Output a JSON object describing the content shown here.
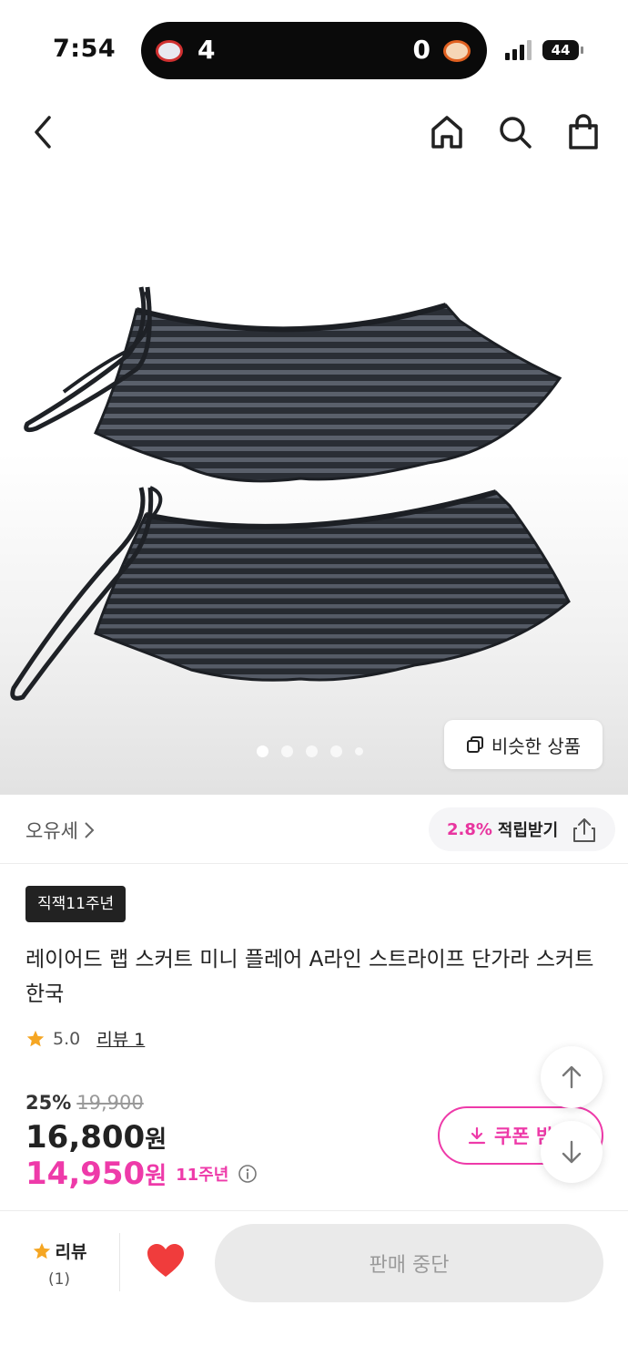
{
  "status_bar": {
    "time": "7:54",
    "live_activity": {
      "home_score": "4",
      "away_score": "0"
    },
    "battery": "44"
  },
  "nav": {
    "back_icon": "chevron-left-icon",
    "home_icon": "home-icon",
    "search_icon": "search-icon",
    "cart_icon": "shopping-bag-icon"
  },
  "gallery": {
    "page_count": 5,
    "active_index": 0,
    "similar_label": "비슷한 상품"
  },
  "brand": {
    "name": "오유세",
    "points_rate": "2.8%",
    "points_label": "적립받기"
  },
  "product": {
    "tag": "직잭11주년",
    "title": "레이어드 랩 스커트 미니 플레어 A라인 스트라이프 단가라 스커트 한국",
    "rating": "5.0",
    "review_link": "리뷰 1",
    "discount_rate": "25%",
    "original_price": "19,900",
    "sale_price": "16,800",
    "currency": "원",
    "event_price": "14,950",
    "event_label": "11주년",
    "coupon_label": "쿠폰 받기"
  },
  "bottom_bar": {
    "review_label": "리뷰",
    "review_count": "(1)",
    "buy_label": "판매 중단"
  },
  "colors": {
    "accent": "#ee3aa9",
    "star": "#f5a623",
    "heart": "#f03c3c"
  }
}
